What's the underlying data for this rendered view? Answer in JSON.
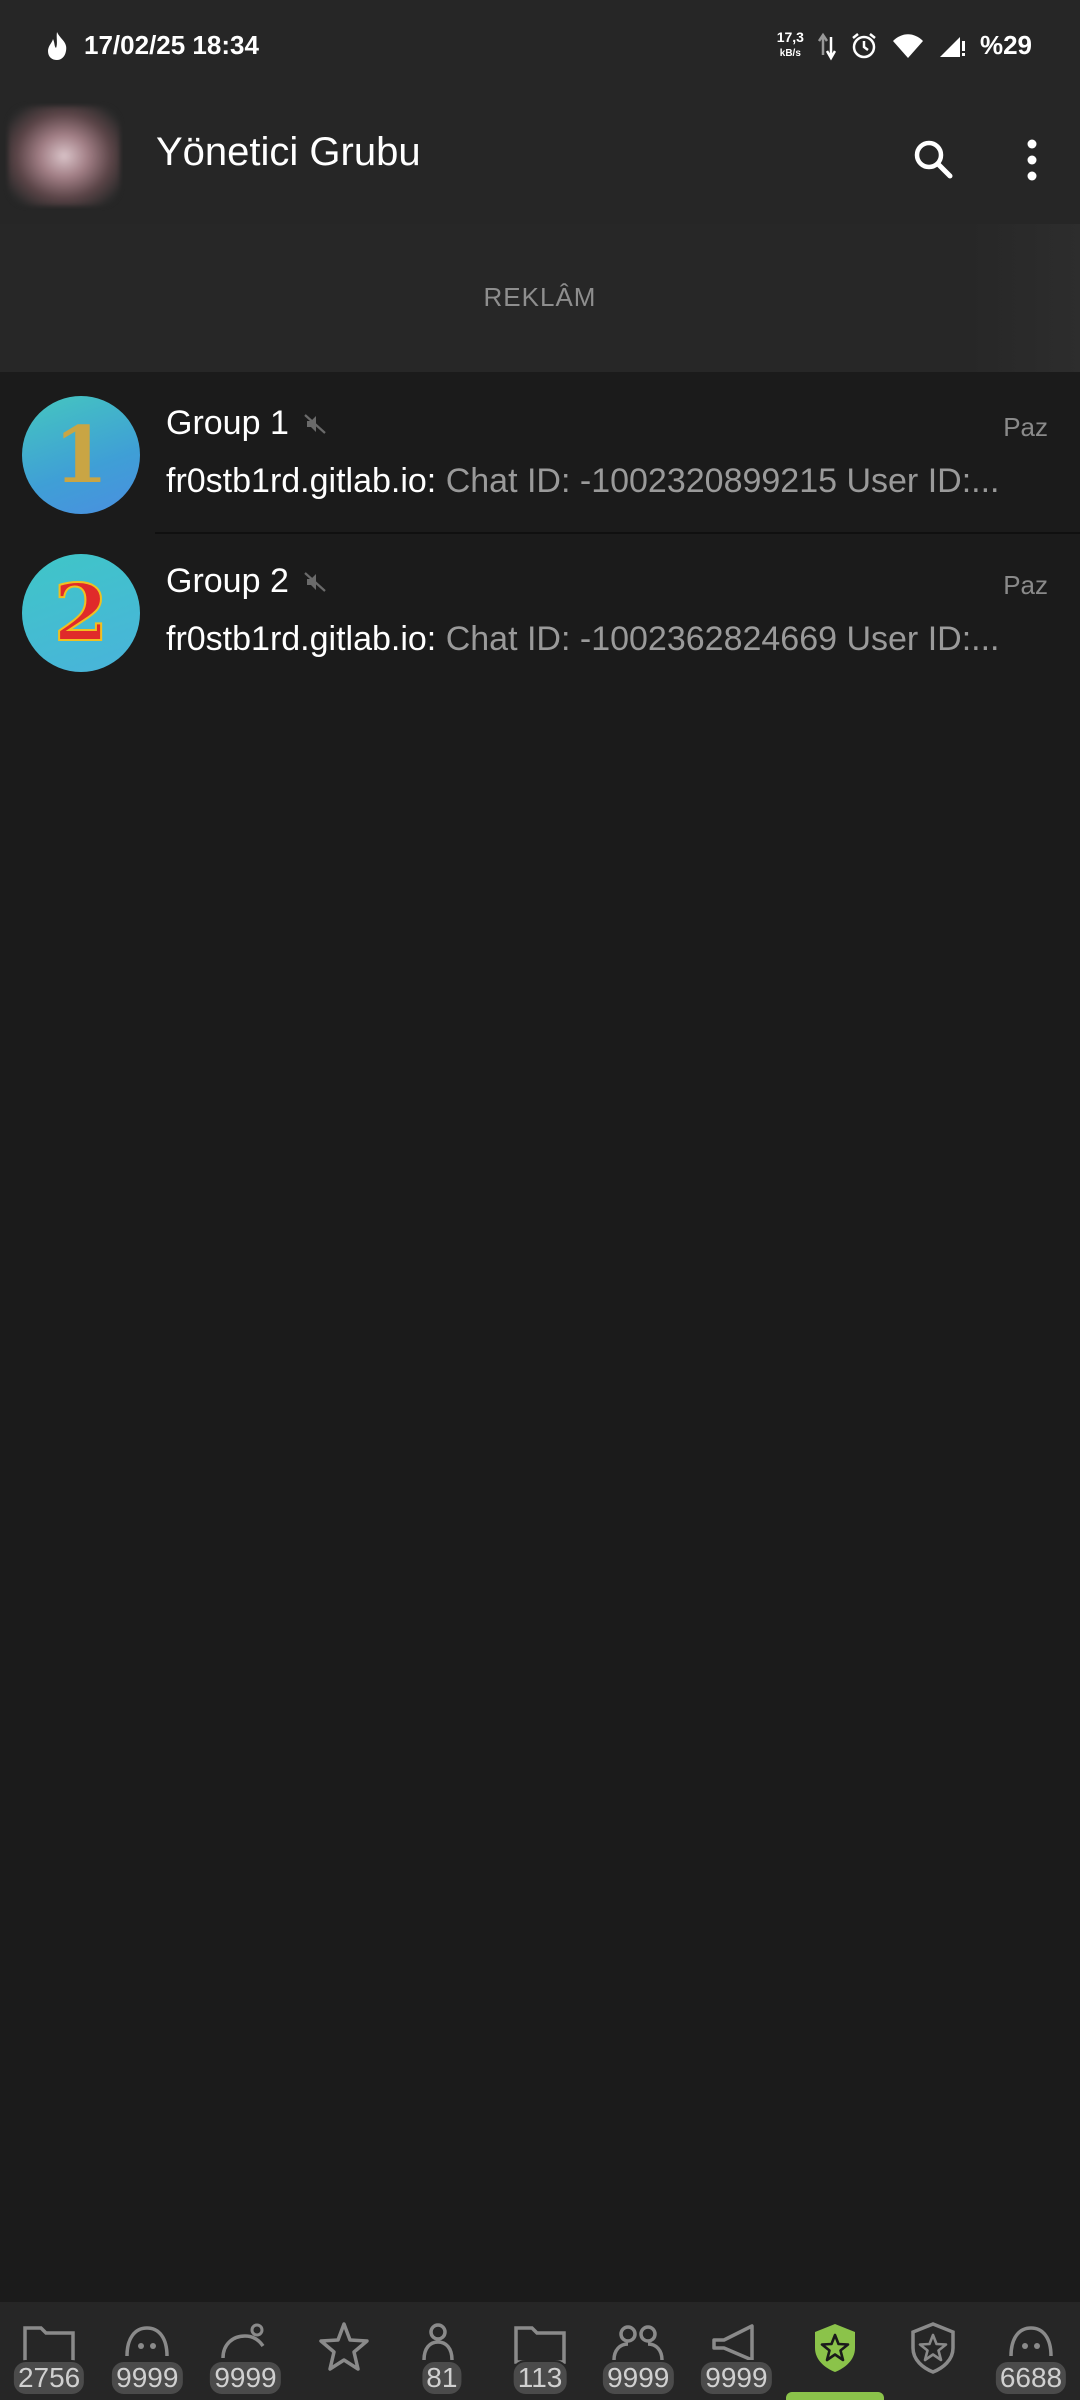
{
  "colors": {
    "accent": "#e8581f",
    "active_tab": "#8bc34a",
    "background": "#1b1b1b",
    "bar": "#262626"
  },
  "statusbar": {
    "datetime": "17/02/25 18:34",
    "net_speed": "17,3",
    "net_unit": "kB/s",
    "battery": "%29",
    "icons": [
      "flame-icon",
      "data-arrows-icon",
      "alarm-icon",
      "wifi-icon",
      "signal-icon"
    ]
  },
  "appbar": {
    "title": "Yönetici Grubu",
    "search_icon": "search-icon",
    "menu_icon": "more-vert-icon"
  },
  "ad": {
    "label": "REKLÂM"
  },
  "chats": [
    {
      "title": "Group 1",
      "avatar_text": "1",
      "muted": true,
      "time": "Paz",
      "sender": "fr0stb1rd.gitlab.io:",
      "message": "Chat ID: -1002320899215 User ID:..."
    },
    {
      "title": "Group 2",
      "avatar_text": "2",
      "muted": true,
      "time": "Paz",
      "sender": "fr0stb1rd.gitlab.io:",
      "message": "Chat ID: -1002362824669 User ID:..."
    }
  ],
  "tabs": [
    {
      "icon": "folder-icon",
      "badge": "2756"
    },
    {
      "icon": "bot-icon",
      "badge": "9999"
    },
    {
      "icon": "user-group-icon",
      "badge": "9999"
    },
    {
      "icon": "star-icon",
      "badge": ""
    },
    {
      "icon": "user-icon",
      "badge": "81"
    },
    {
      "icon": "folder-icon",
      "badge": "113"
    },
    {
      "icon": "people-icon",
      "badge": "9999"
    },
    {
      "icon": "megaphone-icon",
      "badge": "9999"
    },
    {
      "icon": "shield-star-icon",
      "badge": "",
      "active": true
    },
    {
      "icon": "shield-star-outline-icon",
      "badge": ""
    },
    {
      "icon": "bot-icon",
      "badge": "6688"
    }
  ]
}
